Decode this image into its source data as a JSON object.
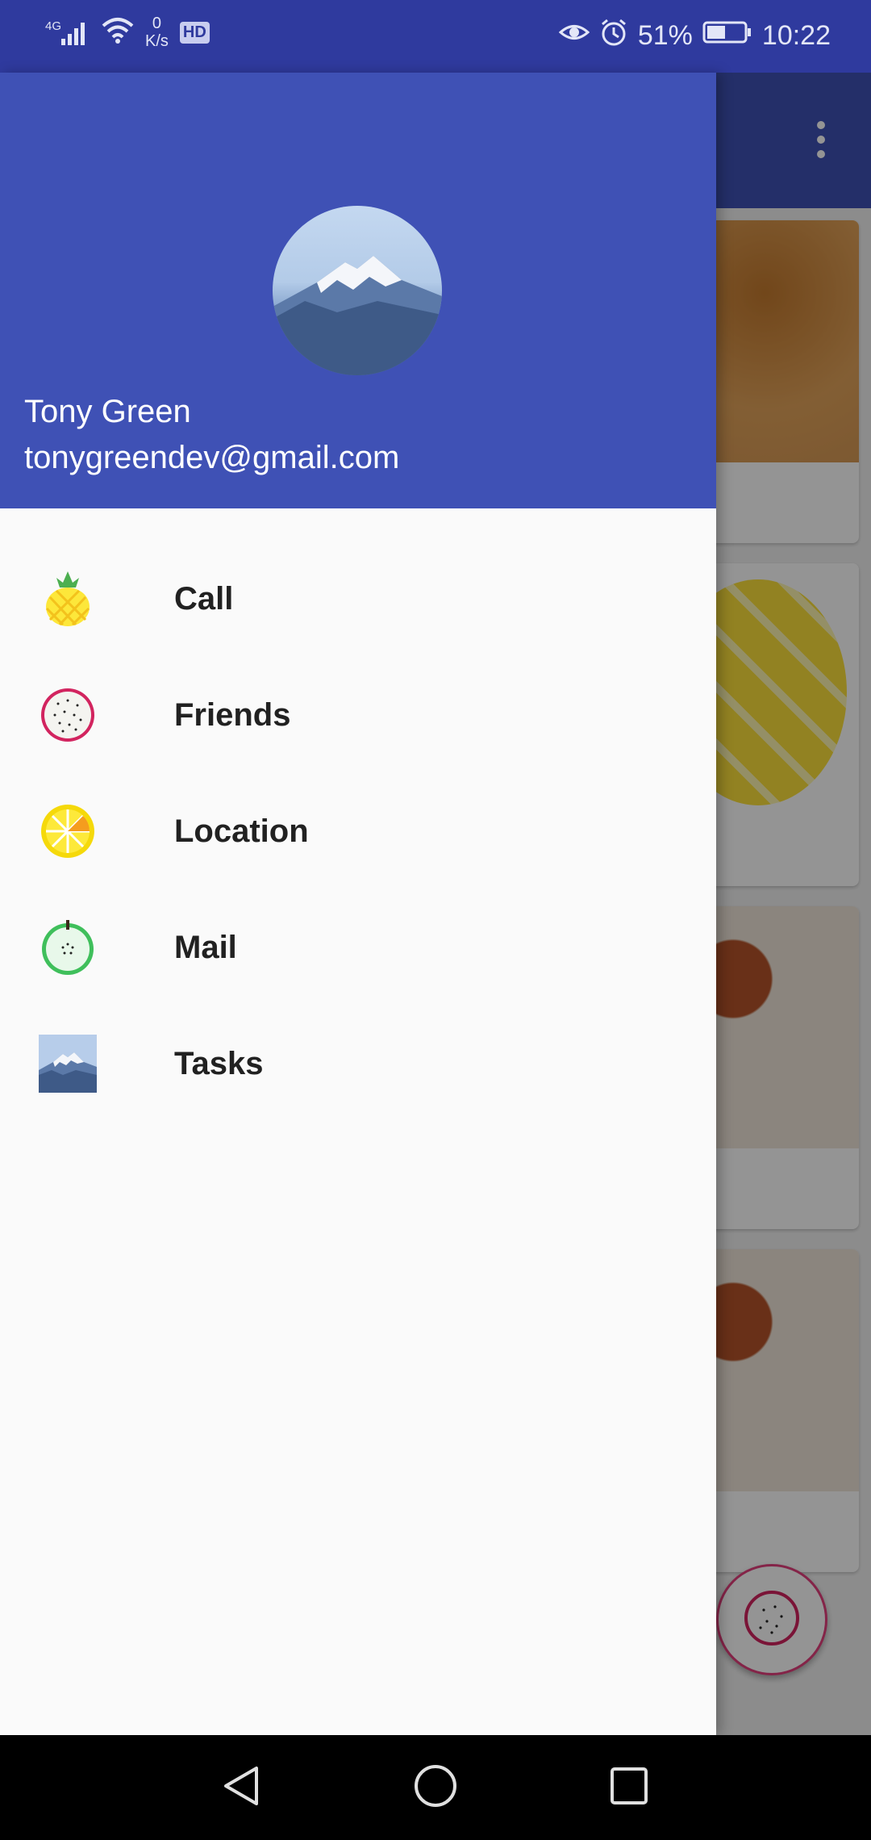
{
  "status_bar": {
    "network_type": "4G",
    "speed_value": "0",
    "speed_unit": "K/s",
    "hd_label": "HD",
    "battery_percent": "51%",
    "battery_level": 0.51,
    "time": "10:22"
  },
  "drawer": {
    "user_name": "Tony Green",
    "user_email": "tonygreendev@gmail.com",
    "items": [
      {
        "label": "Call",
        "icon": "pineapple-icon"
      },
      {
        "label": "Friends",
        "icon": "dragonfruit-icon"
      },
      {
        "label": "Location",
        "icon": "lemon-icon"
      },
      {
        "label": "Mail",
        "icon": "apple-icon"
      },
      {
        "label": "Tasks",
        "icon": "mountain-photo-icon"
      }
    ]
  },
  "colors": {
    "primary": "#3f51b5",
    "status_bar": "#2f3a9e",
    "drawer_bg": "#fafafa",
    "accent": "#e33e7d"
  }
}
